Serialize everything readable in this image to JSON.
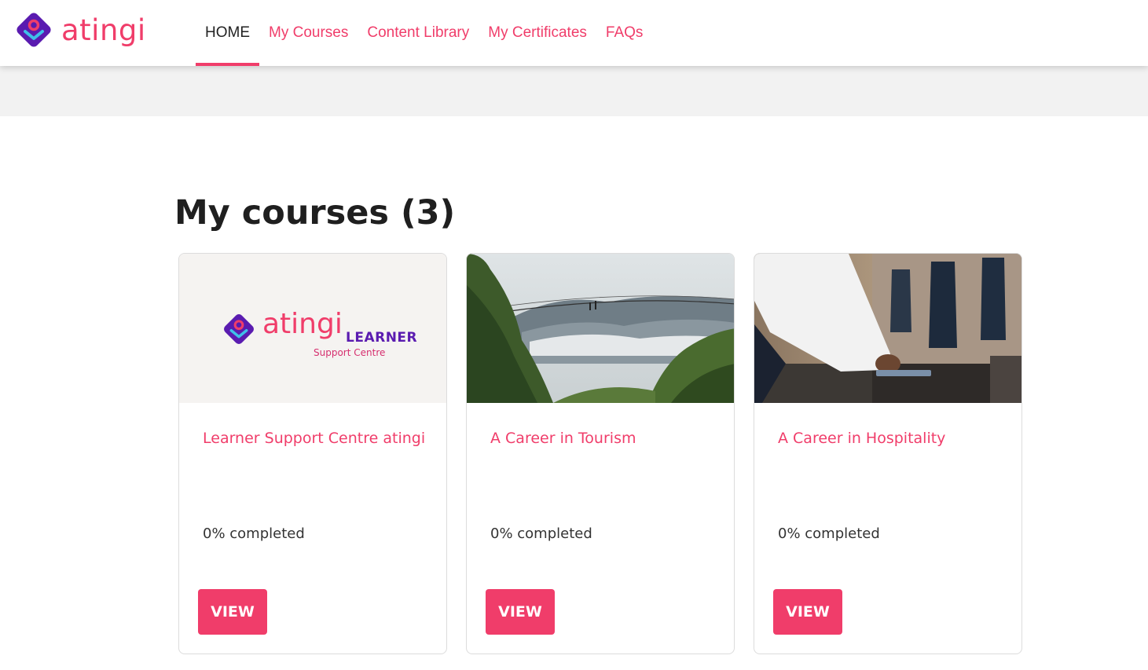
{
  "brand": {
    "name": "atingi",
    "primary_color": "#f03d6a",
    "purple_color": "#5a1bb0"
  },
  "nav": {
    "items": [
      {
        "label": "HOME",
        "active": true
      },
      {
        "label": "My Courses",
        "active": false
      },
      {
        "label": "Content Library",
        "active": false
      },
      {
        "label": "My Certificates",
        "active": false
      },
      {
        "label": "FAQs",
        "active": false
      }
    ]
  },
  "main": {
    "heading": "My courses (3)"
  },
  "courses": [
    {
      "title": "Learner Support Centre atingi",
      "progress_text": "0% completed",
      "progress": 0,
      "button": "VIEW",
      "image": {
        "type": "logo",
        "wordmark": "atingi",
        "line1": "LEARNER",
        "line2": "Support Centre"
      }
    },
    {
      "title": "A Career in Tourism",
      "progress_text": "0% completed",
      "progress": 0,
      "button": "VIEW",
      "image": {
        "type": "photo",
        "subject": "canopy-walkway-forest"
      }
    },
    {
      "title": "A Career in Hospitality",
      "progress_text": "0% completed",
      "progress": 0,
      "button": "VIEW",
      "image": {
        "type": "photo",
        "subject": "waiter-setting-table"
      }
    }
  ]
}
